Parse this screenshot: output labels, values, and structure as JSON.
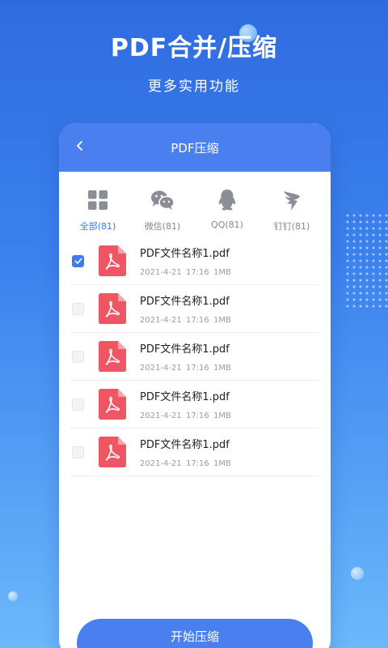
{
  "hero": {
    "title": "PDF合并/压缩",
    "subtitle": "更多实用功能"
  },
  "screen": {
    "title": "PDF压缩",
    "categories": [
      {
        "label": "全部(81)",
        "icon": "grid-icon",
        "active": true
      },
      {
        "label": "微信(81)",
        "icon": "wechat-icon",
        "active": false
      },
      {
        "label": "QQ(81)",
        "icon": "qq-icon",
        "active": false
      },
      {
        "label": "钉钉(81)",
        "icon": "dingtalk-icon",
        "active": false
      }
    ],
    "files": [
      {
        "name": "PDF文件名称1.pdf",
        "date": "2021-4-21",
        "time": "17:16",
        "size": "1MB",
        "checked": true
      },
      {
        "name": "PDF文件名称1.pdf",
        "date": "2021-4-21",
        "time": "17:16",
        "size": "1MB",
        "checked": false
      },
      {
        "name": "PDF文件名称1.pdf",
        "date": "2021-4-21",
        "time": "17:16",
        "size": "1MB",
        "checked": false
      },
      {
        "name": "PDF文件名称1.pdf",
        "date": "2021-4-21",
        "time": "17:16",
        "size": "1MB",
        "checked": false
      },
      {
        "name": "PDF文件名称1.pdf",
        "date": "2021-4-21",
        "time": "17:16",
        "size": "1MB",
        "checked": false
      }
    ],
    "action_label": "开始压缩"
  },
  "colors": {
    "accent": "#4a7ff0",
    "pdf_red": "#ef5563",
    "active_tab": "#3d7bf0"
  }
}
